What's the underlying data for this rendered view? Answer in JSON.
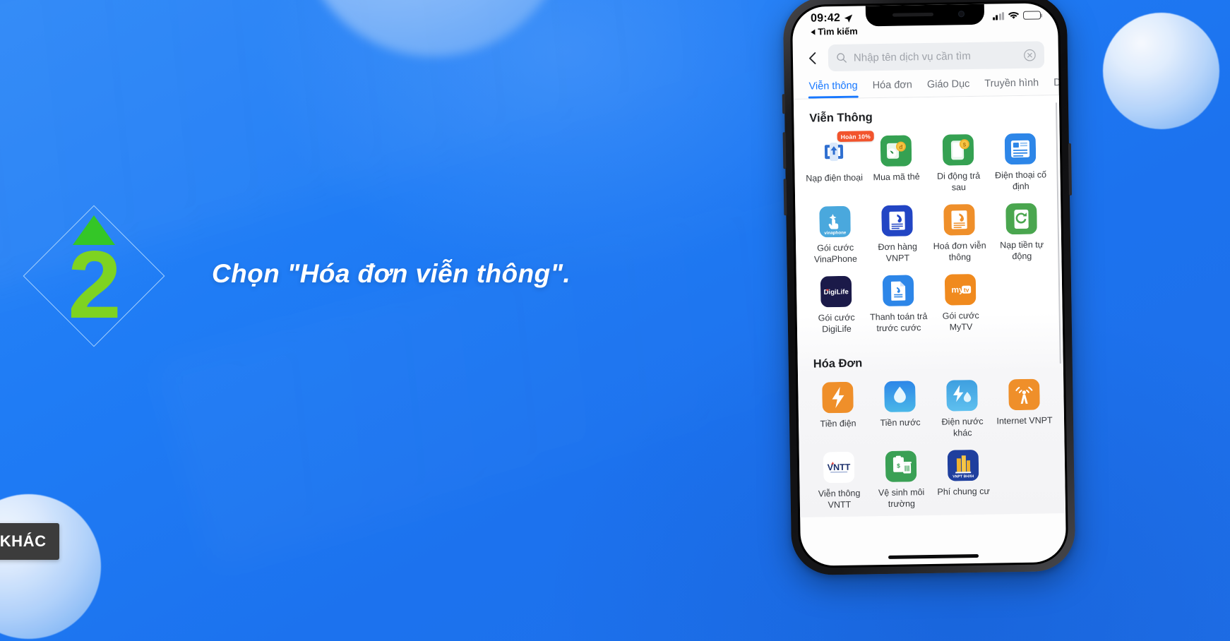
{
  "slide": {
    "step_number": "2",
    "caption": "Chọn \"Hóa đơn viễn thông\".",
    "more_videos_label": "EO KHÁC",
    "accent_green": "#7ed321",
    "triangle_green": "#34c627",
    "background_blue": "#1877f2"
  },
  "phone": {
    "status_bar": {
      "time": "09:42",
      "location_icon": "location-arrow-icon",
      "return_label": "Tìm kiếm",
      "signal_icon": "cellular-signal-icon",
      "wifi_icon": "wifi-icon",
      "battery_icon": "battery-low-power-icon",
      "battery_color": "#f3c322"
    },
    "nav": {
      "back_icon": "chevron-left-icon",
      "search_icon": "search-icon",
      "search_placeholder": "Nhập tên dịch vụ cần tìm",
      "search_value": "",
      "clear_icon": "clear-circle-icon"
    },
    "tabs": [
      {
        "label": "Viễn thông",
        "active": true
      },
      {
        "label": "Hóa đơn",
        "active": false
      },
      {
        "label": "Giáo Dục",
        "active": false
      },
      {
        "label": "Truyền hình",
        "active": false
      },
      {
        "label": "Di chuyển",
        "active": false
      }
    ],
    "sections": [
      {
        "title": "Viễn Thông",
        "items": [
          {
            "label": "Nạp điện thoại",
            "icon": "phone-topup-icon",
            "color": "#2f6fd0",
            "badge": "Hoàn 10%"
          },
          {
            "label": "Mua mã thẻ",
            "icon": "buy-phone-card-icon",
            "color": "#35a152",
            "badge": ""
          },
          {
            "label": "Di động trả sau",
            "icon": "postpaid-mobile-icon",
            "color": "#35a152",
            "badge": ""
          },
          {
            "label": "Điện thoại cố định",
            "icon": "landline-icon",
            "color": "#2d86e8",
            "badge": ""
          },
          {
            "label": "Gói cước VinaPhone",
            "icon": "vinaphone-plan-icon",
            "color": "#4aa8dd",
            "badge": ""
          },
          {
            "label": "Đơn hàng VNPT",
            "icon": "vnpt-order-icon",
            "color": "#2245c4",
            "badge": ""
          },
          {
            "label": "Hoá đơn viễn thông",
            "icon": "telecom-bill-icon",
            "color": "#ef8f2a",
            "badge": ""
          },
          {
            "label": "Nạp tiền tự động",
            "icon": "auto-topup-icon",
            "color": "#4aa64f",
            "badge": ""
          },
          {
            "label": "Gói cước DigiLife",
            "icon": "digilife-plan-icon",
            "color": "#1b1a49",
            "badge": ""
          },
          {
            "label": "Thanh toán trả trước cước",
            "icon": "prepaid-payment-icon",
            "color": "#2d86e8",
            "badge": ""
          },
          {
            "label": "Gói cước MyTV",
            "icon": "mytv-plan-icon",
            "color": "#f08a1e",
            "badge": ""
          }
        ]
      },
      {
        "title": "Hóa Đơn",
        "items": [
          {
            "label": "Tiền điện",
            "icon": "electricity-bill-icon",
            "color": "#ef8f2a",
            "badge": ""
          },
          {
            "label": "Tiền nước",
            "icon": "water-bill-icon",
            "color": "#2d86e8",
            "badge": ""
          },
          {
            "label": "Điện nước khác",
            "icon": "other-utility-bill-icon",
            "color": "#3e9fe0",
            "badge": ""
          },
          {
            "label": "Internet VNPT",
            "icon": "internet-vnpt-icon",
            "color": "#ef8f2a",
            "badge": ""
          },
          {
            "label": "Viễn thông VNTT",
            "icon": "vntt-telecom-icon",
            "color": "#ffffff",
            "badge": ""
          },
          {
            "label": "Vệ sinh môi trường",
            "icon": "sanitation-bill-icon",
            "color": "#3aa055",
            "badge": ""
          },
          {
            "label": "Phí chung cư",
            "icon": "apartment-fee-icon",
            "color": "#1f3f9e",
            "badge": ""
          }
        ]
      }
    ]
  }
}
